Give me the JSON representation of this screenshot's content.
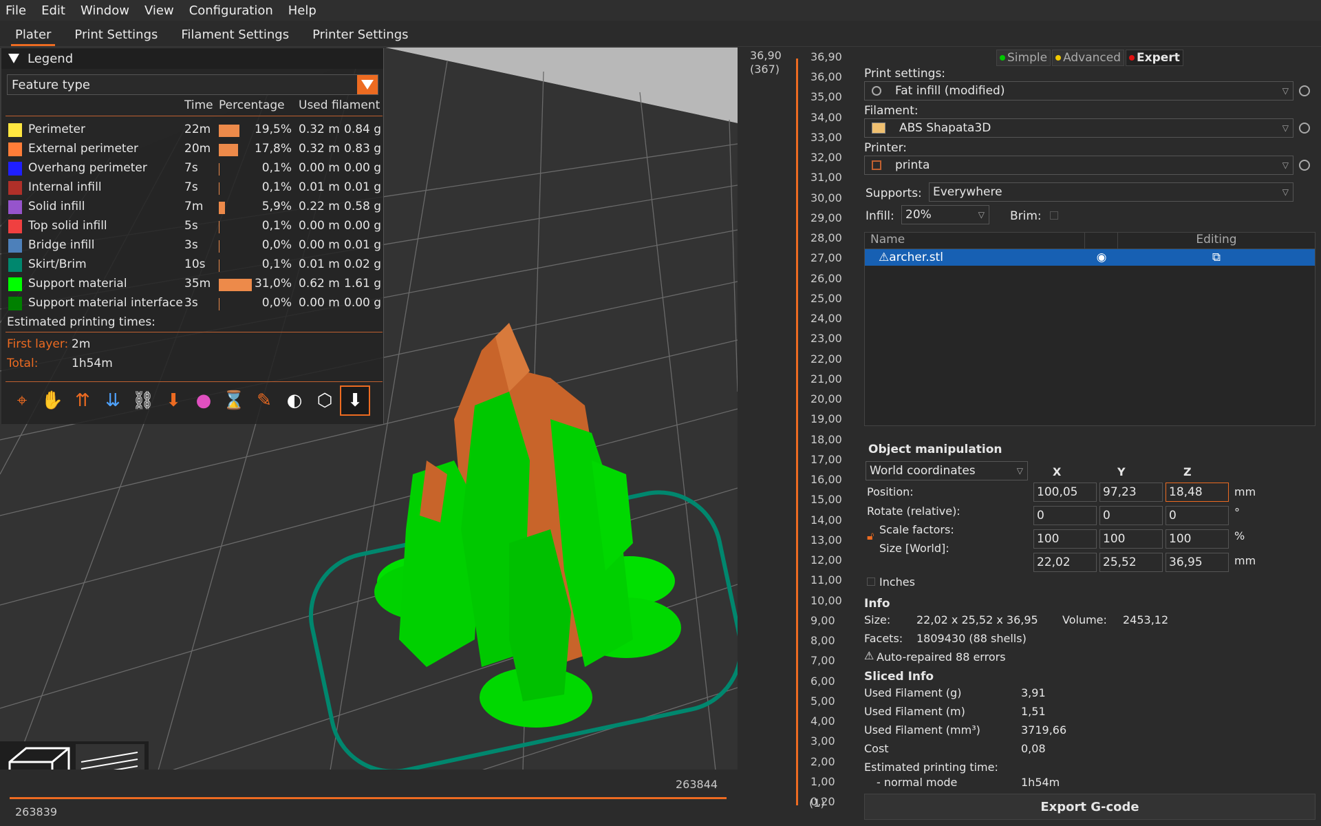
{
  "menu": [
    "File",
    "Edit",
    "Window",
    "View",
    "Configuration",
    "Help"
  ],
  "tabs": [
    "Plater",
    "Print Settings",
    "Filament Settings",
    "Printer Settings"
  ],
  "legend": {
    "title": "Legend",
    "mode": "Feature type",
    "headers": {
      "time": "Time",
      "percentage": "Percentage",
      "used": "Used filament"
    },
    "rows": [
      {
        "name": "Perimeter",
        "color": "#ffe640",
        "time": "22m",
        "pct": "19,5%",
        "m": "0.32 m",
        "g": "0.84 g",
        "frac": 0.195
      },
      {
        "name": "External perimeter",
        "color": "#ff7d38",
        "time": "20m",
        "pct": "17,8%",
        "m": "0.32 m",
        "g": "0.83 g",
        "frac": 0.178
      },
      {
        "name": "Overhang perimeter",
        "color": "#1f1fff",
        "time": "7s",
        "pct": "0,1%",
        "m": "0.00 m",
        "g": "0.00 g",
        "frac": 0.001
      },
      {
        "name": "Internal infill",
        "color": "#b03029",
        "time": "7s",
        "pct": "0,1%",
        "m": "0.01 m",
        "g": "0.01 g",
        "frac": 0.001
      },
      {
        "name": "Solid infill",
        "color": "#9654cc",
        "time": "7m",
        "pct": "5,9%",
        "m": "0.22 m",
        "g": "0.58 g",
        "frac": 0.059
      },
      {
        "name": "Top solid infill",
        "color": "#f04040",
        "time": "5s",
        "pct": "0,1%",
        "m": "0.00 m",
        "g": "0.00 g",
        "frac": 0.001
      },
      {
        "name": "Bridge infill",
        "color": "#4d80ba",
        "time": "3s",
        "pct": "0,0%",
        "m": "0.00 m",
        "g": "0.01 g",
        "frac": 0.0
      },
      {
        "name": "Skirt/Brim",
        "color": "#00876e",
        "time": "10s",
        "pct": "0,1%",
        "m": "0.01 m",
        "g": "0.02 g",
        "frac": 0.001
      },
      {
        "name": "Support material",
        "color": "#00ff00",
        "time": "35m",
        "pct": "31,0%",
        "m": "0.62 m",
        "g": "1.61 g",
        "frac": 0.31
      },
      {
        "name": "Support material interface",
        "color": "#008000",
        "time": "3s",
        "pct": "0,0%",
        "m": "0.00 m",
        "g": "0.00 g",
        "frac": 0.0
      }
    ],
    "est_title": "Estimated printing times:",
    "first_layer_label": "First layer:",
    "first_layer": "2m",
    "total_label": "Total:",
    "total": "1h54m"
  },
  "hslider": {
    "left": "263839",
    "right": "263844"
  },
  "vslider": {
    "top": "36,90",
    "top_sub": "(367)",
    "bottom": "0,20",
    "bottom_sub": "(1)",
    "ticks": [
      "36,90",
      "36,00",
      "35,00",
      "34,00",
      "33,00",
      "32,00",
      "31,00",
      "30,00",
      "29,00",
      "28,00",
      "27,00",
      "26,00",
      "25,00",
      "24,00",
      "23,00",
      "22,00",
      "21,00",
      "20,00",
      "19,00",
      "18,00",
      "17,00",
      "16,00",
      "15,00",
      "14,00",
      "13,00",
      "12,00",
      "11,00",
      "10,00",
      "9,00",
      "8,00",
      "7,00",
      "6,00",
      "5,00",
      "4,00",
      "3,00",
      "2,00",
      "1,00",
      "0,20"
    ]
  },
  "panel": {
    "modes": [
      {
        "label": "Simple",
        "color": "#00c800"
      },
      {
        "label": "Advanced",
        "color": "#f0c800"
      },
      {
        "label": "Expert",
        "color": "#e01010"
      }
    ],
    "print_label": "Print settings:",
    "print": "Fat infill (modified)",
    "filament_label": "Filament:",
    "filament": "ABS Shapata3D",
    "printer_label": "Printer:",
    "printer": "printa",
    "supports_label": "Supports:",
    "supports": "Everywhere",
    "infill_label": "Infill:",
    "infill": "20%",
    "brim_label": "Brim:",
    "list": {
      "name": "Name",
      "editing": "Editing",
      "item": "archer.stl"
    },
    "om": {
      "title": "Object manipulation",
      "coords": "World coordinates",
      "x": "X",
      "y": "Y",
      "z": "Z",
      "position_label": "Position:",
      "position": [
        "100,05",
        "97,23",
        "18,48"
      ],
      "pos_unit": "mm",
      "rotate_label": "Rotate (relative):",
      "rotate": [
        "0",
        "0",
        "0"
      ],
      "rot_unit": "°",
      "scale_label": "Scale factors:",
      "scale": [
        "100",
        "100",
        "100"
      ],
      "scale_unit": "%",
      "size_label": "Size [World]:",
      "size": [
        "22,02",
        "25,52",
        "36,95"
      ],
      "size_unit": "mm",
      "inches": "Inches"
    },
    "info": {
      "title": "Info",
      "size_label": "Size:",
      "size": "22,02 x 25,52 x 36,95",
      "volume_label": "Volume:",
      "volume": "2453,12",
      "facets_label": "Facets:",
      "facets": "1809430 (88 shells)",
      "repaired": "Auto-repaired 88 errors"
    },
    "sliced": {
      "title": "Sliced Info",
      "rows": [
        {
          "k": "Used Filament (g)",
          "v": "3,91"
        },
        {
          "k": "Used Filament (m)",
          "v": "1,51"
        },
        {
          "k": "Used Filament (mm³)",
          "v": "3719,66"
        },
        {
          "k": "Cost",
          "v": "0,08"
        }
      ],
      "est": "Estimated printing time:",
      "mode": "- normal mode",
      "mode_val": "1h54m"
    },
    "export": "Export G-code"
  }
}
